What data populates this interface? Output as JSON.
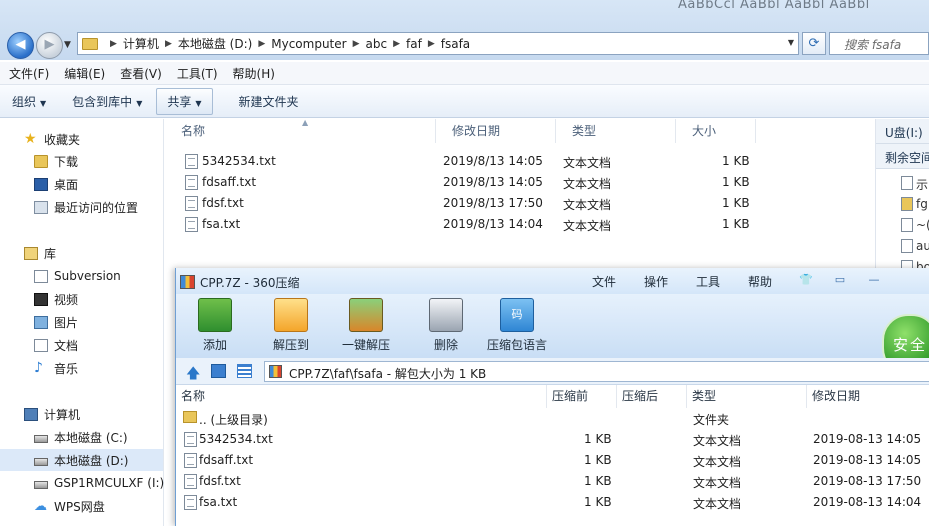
{
  "explorer": {
    "title_preview": "AaBbCcl  AaBbl AaBbl AaBbl",
    "breadcrumbs": [
      "计算机",
      "本地磁盘 (D:)",
      "Mycomputer",
      "abc",
      "faf",
      "fsafa"
    ],
    "search_placeholder": "搜索 fsafa",
    "menu": [
      "文件(F)",
      "编辑(E)",
      "查看(V)",
      "工具(T)",
      "帮助(H)"
    ],
    "toolbar": {
      "organize": "组织",
      "include": "包含到库中",
      "share": "共享",
      "new_folder": "新建文件夹"
    },
    "nav": {
      "favorites": "收藏夹",
      "downloads": "下载",
      "desktop": "桌面",
      "recent": "最近访问的位置",
      "libraries": "库",
      "subversion": "Subversion",
      "videos": "视频",
      "pictures": "图片",
      "documents": "文档",
      "music": "音乐",
      "computer": "计算机",
      "drive_c": "本地磁盘 (C:)",
      "drive_d": "本地磁盘 (D:)",
      "drive_i": "GSP1RMCULXF (I:)",
      "wps": "WPS网盘"
    },
    "columns": {
      "name": "名称",
      "modified": "修改日期",
      "type": "类型",
      "size": "大小"
    },
    "files": [
      {
        "name": "5342534.txt",
        "modified": "2019/8/13 14:05",
        "type": "文本文档",
        "size": "1 KB"
      },
      {
        "name": "fdsaff.txt",
        "modified": "2019/8/13 14:05",
        "type": "文本文档",
        "size": "1 KB"
      },
      {
        "name": "fdsf.txt",
        "modified": "2019/8/13 17:50",
        "type": "文本文档",
        "size": "1 KB"
      },
      {
        "name": "fsa.txt",
        "modified": "2019/8/13 14:04",
        "type": "文本文档",
        "size": "1 KB"
      }
    ],
    "right_pane": {
      "drive": "U盘(I:)",
      "free": "剩余空间",
      "items": [
        "示",
        "fg",
        "~(",
        "au",
        "bo"
      ]
    }
  },
  "zip": {
    "title": "CPP.7Z - 360压缩",
    "menu": [
      "文件",
      "操作",
      "工具",
      "帮助"
    ],
    "tools": [
      "添加",
      "解压到",
      "一键解压",
      "删除",
      "压缩包语言"
    ],
    "tool_comment_glyph": "码",
    "shield": "安全",
    "path": "CPP.7Z\\faf\\fsafa - 解包大小为 1 KB",
    "columns": {
      "name": "名称",
      "compressed": "压缩前",
      "after": "压缩后",
      "type": "类型",
      "modified": "修改日期"
    },
    "parent": {
      "name": ".. (上级目录)",
      "type": "文件夹"
    },
    "files": [
      {
        "name": "5342534.txt",
        "before": "1 KB",
        "type": "文本文档",
        "modified": "2019-08-13 14:05"
      },
      {
        "name": "fdsaff.txt",
        "before": "1 KB",
        "type": "文本文档",
        "modified": "2019-08-13 14:05"
      },
      {
        "name": "fdsf.txt",
        "before": "1 KB",
        "type": "文本文档",
        "modified": "2019-08-13 17:50"
      },
      {
        "name": "fsa.txt",
        "before": "1 KB",
        "type": "文本文档",
        "modified": "2019-08-13 14:04"
      }
    ]
  }
}
